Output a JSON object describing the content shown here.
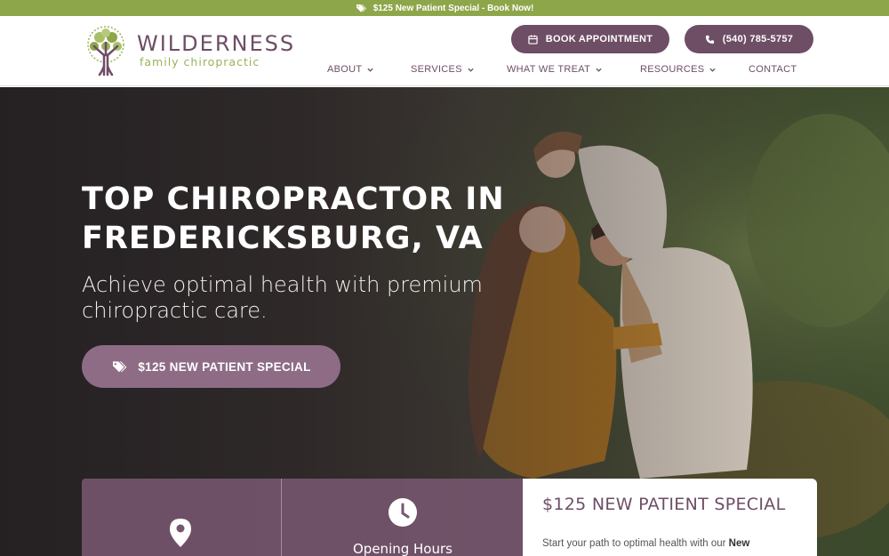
{
  "promo_bar": {
    "text": "$125 New Patient Special - Book Now!",
    "icon": "tag-icon"
  },
  "logo": {
    "name": "WILDERNESS",
    "tagline": "family chiropractic",
    "icon": "tree-icon"
  },
  "header_buttons": {
    "book": {
      "label": "BOOK APPOINTMENT",
      "icon": "calendar-icon"
    },
    "phone": {
      "label": "(540) 785-5757",
      "icon": "phone-icon"
    }
  },
  "nav": {
    "about": "ABOUT",
    "services": "SERVICES",
    "what_we_treat": "WHAT WE TREAT",
    "resources": "RESOURCES",
    "contact": "CONTACT"
  },
  "hero": {
    "title": "TOP CHIROPRACTOR IN FREDERICKSBURG, VA",
    "subtitle": "Achieve optimal health with premium chiropractic care.",
    "cta_label": "$125 NEW PATIENT SPECIAL",
    "cta_icon": "tag-icon"
  },
  "info_cards": {
    "location_icon": "location-pin-icon",
    "hours_icon": "clock-icon",
    "hours_label": "Opening Hours"
  },
  "special_card": {
    "title": "$125 NEW PATIENT SPECIAL",
    "text_start": "Start your path to optimal health with our ",
    "text_bold": "New"
  },
  "colors": {
    "brand_purple": "#6d4e65",
    "brand_green": "#8da64a",
    "cta_purple": "#8e6c86"
  }
}
